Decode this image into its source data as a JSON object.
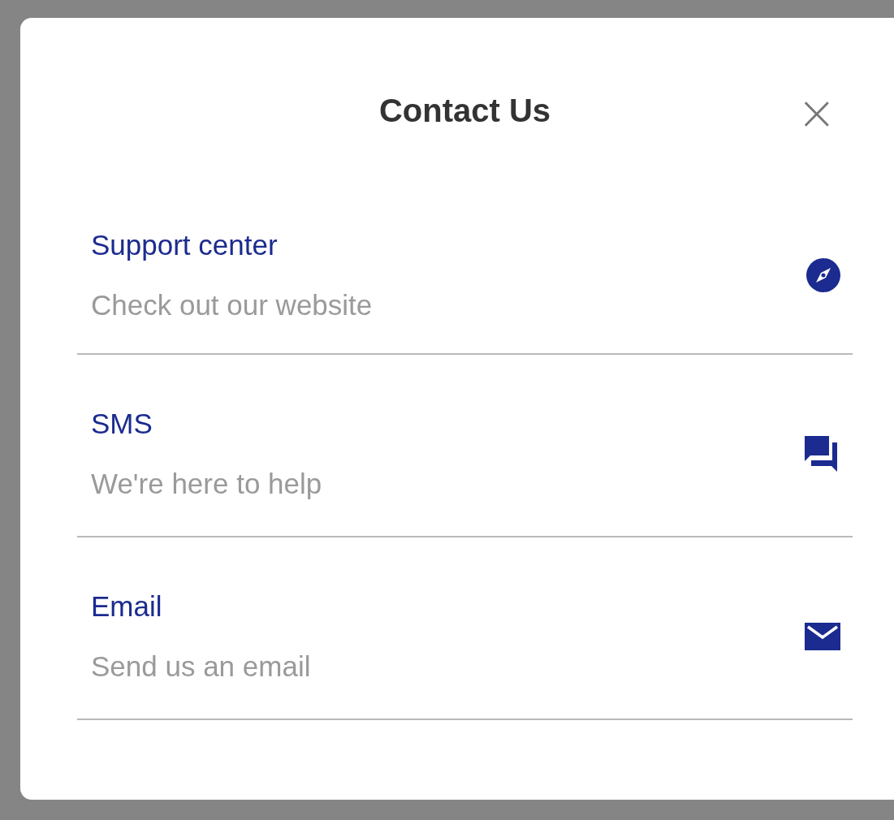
{
  "dialog": {
    "title": "Contact Us",
    "close": "×"
  },
  "items": [
    {
      "kind": "website",
      "label": "Support center",
      "description": "Check out our website"
    },
    {
      "kind": "sms",
      "label": "SMS",
      "description": "We're here to help"
    },
    {
      "kind": "email",
      "label": "Email",
      "description": "Send us an email"
    }
  ]
}
